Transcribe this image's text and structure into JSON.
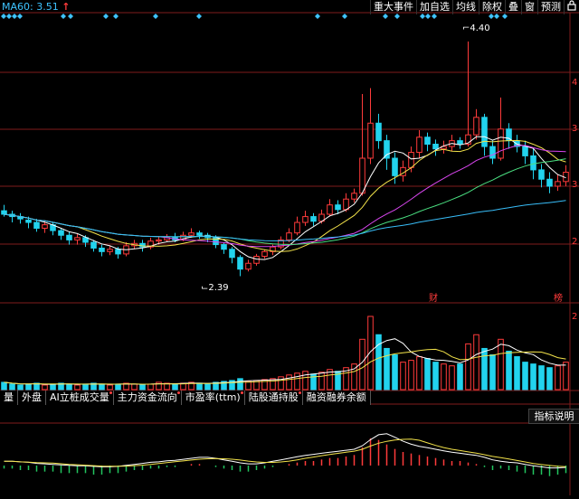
{
  "header": {
    "ma_label": "MA60: 3.51",
    "ma_arrow": "↑",
    "toolbar": [
      {
        "label": "重大事件",
        "name": "toolbar-major-events"
      },
      {
        "label": "加自选",
        "name": "toolbar-add-watchlist"
      },
      {
        "label": "均线",
        "name": "toolbar-moving-average"
      },
      {
        "label": "除权",
        "name": "toolbar-ex-rights"
      },
      {
        "label": "叠",
        "name": "toolbar-overlay"
      },
      {
        "label": "窗",
        "name": "toolbar-window"
      },
      {
        "label": "预测",
        "name": "toolbar-forecast"
      }
    ],
    "lock_icon": "lock-icon"
  },
  "chart": {
    "high_label": "4.40",
    "low_label": "2.39",
    "marker_cai": "财",
    "marker_bang": "榜",
    "y_ticks_price": [
      "4",
      "3",
      "3",
      "2"
    ],
    "y_tick_volume": "2",
    "colors": {
      "up": "#ff3b3b",
      "down": "#22d3ee",
      "ma5": "#ffffff",
      "ma10": "#f2e24a",
      "ma20": "#d946ef",
      "ma30": "#4ade80",
      "ma60": "#38bdf8",
      "grid": "#7f1d1d"
    }
  },
  "tabs": [
    "量",
    "外盘",
    "AI立桩成交量",
    "主力资金流向",
    "市盈率(ttm)",
    "陆股通持股",
    "融资融券余额"
  ],
  "indicator_button": "指标说明",
  "chart_data": {
    "type": "candlestick",
    "title": "",
    "ylim": [
      2.2,
      4.6
    ],
    "candles": [
      [
        2.95,
        2.92,
        3.0,
        2.9
      ],
      [
        2.92,
        2.9,
        2.95,
        2.85
      ],
      [
        2.9,
        2.88,
        2.93,
        2.84
      ],
      [
        2.87,
        2.85,
        2.9,
        2.8
      ],
      [
        2.85,
        2.8,
        2.88,
        2.77
      ],
      [
        2.8,
        2.83,
        2.86,
        2.76
      ],
      [
        2.83,
        2.78,
        2.85,
        2.74
      ],
      [
        2.78,
        2.74,
        2.8,
        2.7
      ],
      [
        2.74,
        2.7,
        2.77,
        2.66
      ],
      [
        2.7,
        2.72,
        2.75,
        2.66
      ],
      [
        2.72,
        2.68,
        2.74,
        2.64
      ],
      [
        2.68,
        2.63,
        2.7,
        2.6
      ],
      [
        2.63,
        2.6,
        2.66,
        2.56
      ],
      [
        2.6,
        2.62,
        2.65,
        2.57
      ],
      [
        2.62,
        2.58,
        2.64,
        2.54
      ],
      [
        2.58,
        2.65,
        2.68,
        2.56
      ],
      [
        2.65,
        2.67,
        2.7,
        2.62
      ],
      [
        2.67,
        2.64,
        2.7,
        2.6
      ],
      [
        2.64,
        2.69,
        2.72,
        2.62
      ],
      [
        2.69,
        2.7,
        2.73,
        2.66
      ],
      [
        2.7,
        2.72,
        2.75,
        2.68
      ],
      [
        2.72,
        2.7,
        2.76,
        2.68
      ],
      [
        2.7,
        2.74,
        2.77,
        2.69
      ],
      [
        2.74,
        2.76,
        2.8,
        2.72
      ],
      [
        2.76,
        2.74,
        2.78,
        2.71
      ],
      [
        2.74,
        2.72,
        2.76,
        2.68
      ],
      [
        2.72,
        2.66,
        2.74,
        2.63
      ],
      [
        2.66,
        2.62,
        2.68,
        2.58
      ],
      [
        2.62,
        2.55,
        2.64,
        2.5
      ],
      [
        2.55,
        2.45,
        2.57,
        2.39
      ],
      [
        2.45,
        2.5,
        2.53,
        2.43
      ],
      [
        2.5,
        2.56,
        2.58,
        2.48
      ],
      [
        2.56,
        2.6,
        2.62,
        2.54
      ],
      [
        2.6,
        2.64,
        2.66,
        2.57
      ],
      [
        2.64,
        2.7,
        2.73,
        2.62
      ],
      [
        2.7,
        2.76,
        2.8,
        2.68
      ],
      [
        2.76,
        2.85,
        2.9,
        2.74
      ],
      [
        2.85,
        2.9,
        2.95,
        2.82
      ],
      [
        2.9,
        2.86,
        2.93,
        2.82
      ],
      [
        2.86,
        2.92,
        2.96,
        2.84
      ],
      [
        2.92,
        3.0,
        3.05,
        2.9
      ],
      [
        3.0,
        2.96,
        3.04,
        2.92
      ],
      [
        2.96,
        3.05,
        3.1,
        2.94
      ],
      [
        3.05,
        3.1,
        3.14,
        3.02
      ],
      [
        3.1,
        3.4,
        3.95,
        3.08
      ],
      [
        3.4,
        3.7,
        4.0,
        3.35
      ],
      [
        3.7,
        3.55,
        3.78,
        3.48
      ],
      [
        3.55,
        3.4,
        3.6,
        3.3
      ],
      [
        3.4,
        3.25,
        3.45,
        3.18
      ],
      [
        3.25,
        3.32,
        3.38,
        3.2
      ],
      [
        3.32,
        3.45,
        3.5,
        3.28
      ],
      [
        3.45,
        3.58,
        3.64,
        3.4
      ],
      [
        3.58,
        3.52,
        3.62,
        3.46
      ],
      [
        3.52,
        3.48,
        3.56,
        3.42
      ],
      [
        3.48,
        3.5,
        3.55,
        3.44
      ],
      [
        3.5,
        3.55,
        3.6,
        3.46
      ],
      [
        3.55,
        3.52,
        3.58,
        3.48
      ],
      [
        3.52,
        3.6,
        4.4,
        3.5
      ],
      [
        3.6,
        3.75,
        3.82,
        3.56
      ],
      [
        3.75,
        3.5,
        3.78,
        3.42
      ],
      [
        3.5,
        3.4,
        3.55,
        3.35
      ],
      [
        3.4,
        3.65,
        3.92,
        3.38
      ],
      [
        3.65,
        3.55,
        3.7,
        3.48
      ],
      [
        3.55,
        3.5,
        3.6,
        3.45
      ],
      [
        3.5,
        3.42,
        3.55,
        3.35
      ],
      [
        3.42,
        3.3,
        3.48,
        3.22
      ],
      [
        3.3,
        3.22,
        3.35,
        3.15
      ],
      [
        3.22,
        3.16,
        3.28,
        3.1
      ],
      [
        3.16,
        3.2,
        3.26,
        3.12
      ],
      [
        3.2,
        3.28,
        3.34,
        3.16
      ]
    ],
    "volume": [
      8,
      6,
      5,
      6,
      7,
      5,
      6,
      7,
      6,
      5,
      6,
      7,
      6,
      5,
      6,
      7,
      6,
      5,
      6,
      8,
      7,
      6,
      7,
      8,
      7,
      6,
      8,
      9,
      10,
      12,
      9,
      10,
      11,
      12,
      14,
      16,
      18,
      20,
      17,
      19,
      22,
      20,
      24,
      28,
      55,
      80,
      60,
      45,
      38,
      30,
      32,
      36,
      34,
      30,
      28,
      26,
      28,
      50,
      60,
      45,
      38,
      55,
      42,
      36,
      30,
      28,
      26,
      24,
      26,
      30
    ],
    "macd": [
      -2,
      -2,
      -3,
      -3,
      -4,
      -4,
      -4,
      -5,
      -5,
      -5,
      -5,
      -6,
      -6,
      -5,
      -5,
      -4,
      -3,
      -3,
      -2,
      -2,
      -1,
      -1,
      0,
      1,
      1,
      0,
      -1,
      -2,
      -3,
      -4,
      -4,
      -3,
      -2,
      -1,
      0,
      1,
      2,
      3,
      3,
      4,
      5,
      5,
      6,
      7,
      12,
      18,
      17,
      14,
      11,
      9,
      8,
      7,
      6,
      5,
      4,
      3,
      3,
      2,
      1,
      -1,
      -3,
      -2,
      -3,
      -4,
      -5,
      -6,
      -6,
      -7,
      -6,
      -5
    ]
  }
}
